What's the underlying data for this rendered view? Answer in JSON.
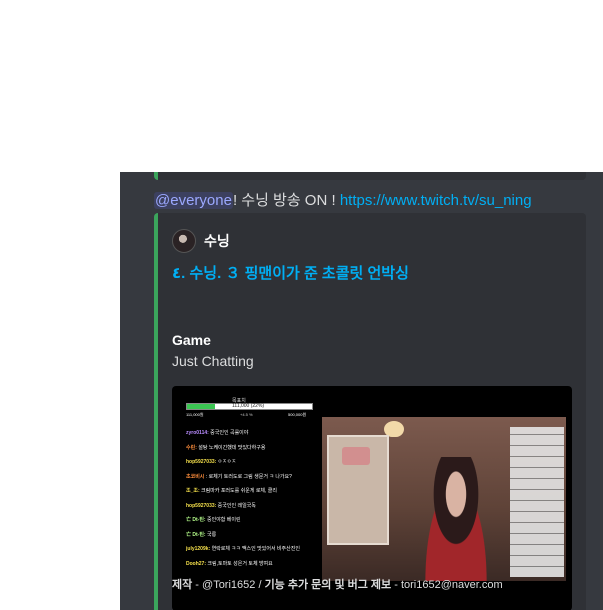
{
  "message": {
    "mention": "@everyone",
    "text": "! 수닝 방송 ON ! ",
    "link": "https://www.twitch.tv/su_ning"
  },
  "embed": {
    "accent_color": "#3ba55c",
    "author": {
      "name": "수닝"
    },
    "title": "٤. 수닝. ３ 핑맨이가 준 초콜릿 언박싱",
    "fields": [
      {
        "name": "Game",
        "value": "Just Chatting"
      }
    ],
    "thumbnail": {
      "bar_label": "목표치",
      "bar_value": "111,000 (22%)",
      "bar_left": "111,000원",
      "bar_mid": "+4.5 %",
      "bar_right": "500,000원",
      "progress_percent": 22,
      "chat": [
        {
          "user": "zyro0114:",
          "text": "중국인인 곡률이야",
          "cls": "u"
        },
        {
          "user": "수린:",
          "text": "설탕 노케이긴했데 맛있다하구용",
          "cls": "u o"
        },
        {
          "user": "hop5927033:",
          "text": "ㅇㅈㅇㅈ",
          "cls": "u y"
        },
        {
          "user": "초코비시",
          "text": ": 로체기 토러도로 그림 생문거 ㅋ 나가요?",
          "cls": "u o"
        },
        {
          "user": "조_조:",
          "text": "크림마카 포러도를 쉬운게 로체, 클리",
          "cls": "u y"
        },
        {
          "user": "hop5927033:",
          "text": "중국인인 레일국독",
          "cls": "u y"
        },
        {
          "user": "亡 Dt-틴:",
          "text": "중인야함 베이린",
          "cls": "u g"
        },
        {
          "user": "亡 Dt-틴:",
          "text": "국릉",
          "cls": "u g"
        },
        {
          "user": "july1209k:",
          "text": "연락로체 ㅋㅋ 맥스인 맛있어서 비주산진인",
          "cls": "u y"
        },
        {
          "user": "Dooh27:",
          "text": "크림,토마토 성은거 토체 방여요",
          "cls": "u y"
        }
      ]
    },
    "footer": {
      "label1": "제작",
      "credit": " - @Tori1652 / ",
      "label2": "기능 추가 문의 및 버그 제보",
      "contact": " - tori1652@naver.com"
    }
  },
  "colors": {
    "chat_bg": "#36393f",
    "embed_bg": "#2f3136",
    "link": "#00aff4",
    "mention": "#9ba8ff"
  }
}
